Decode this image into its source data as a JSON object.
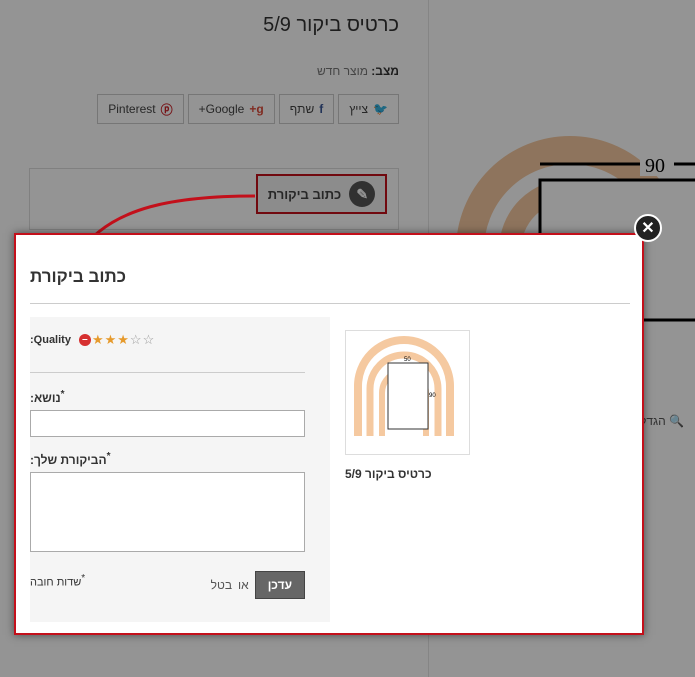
{
  "background": {
    "product_title": "כרטיס ביקור 5/9",
    "condition_label": "מצב:",
    "condition_value": "מוצר חדש",
    "share": {
      "twitter": "צייץ",
      "facebook": "שתף",
      "google": "Google+",
      "pinterest": "Pinterest"
    },
    "write_review": "כתוב ביקורת",
    "dimension_label": "90",
    "zoom_label": "הגדל"
  },
  "modal": {
    "title": "כתוב ביקורת",
    "close_icon": "close-icon",
    "quality_label": ":Quality",
    "rating": {
      "value": 3,
      "max": 5
    },
    "subject_label": "נושא:",
    "subject_value": "",
    "review_label": "הביקורת שלך:",
    "review_value": "",
    "required_mark": "*",
    "required_note": "שדות חובה",
    "submit": "עדכן",
    "or": "או",
    "cancel": "בטל",
    "product_name": "כרטיס ביקור 5/9",
    "thumb_width_label": "50",
    "thumb_height_label": "90"
  },
  "colors": {
    "accent_red": "#c3101b",
    "star": "#e69a2c",
    "logo_orange": "#f5c9a0"
  }
}
